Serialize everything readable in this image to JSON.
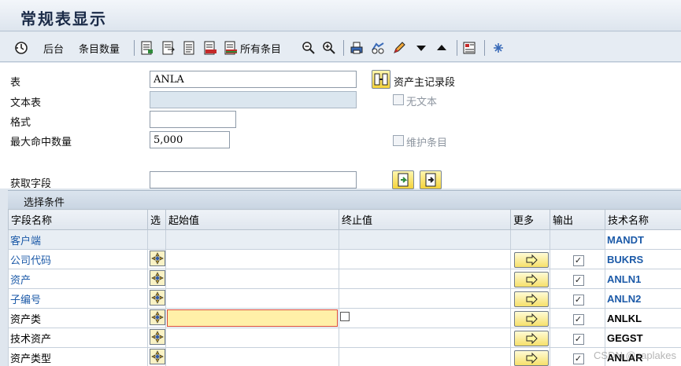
{
  "window": {
    "title": "常规表显示"
  },
  "toolbar": {
    "back_label": "后台",
    "entries_count_label": "条目数量",
    "all_entries_label": "所有条目"
  },
  "form": {
    "table_label": "表",
    "table_value": "ANLA",
    "text_table_label": "文本表",
    "text_table_value": "",
    "format_label": "格式",
    "format_value": "",
    "max_hits_label": "最大命中数量",
    "max_hits_value": "5,000",
    "get_fields_label": "获取字段",
    "get_fields_value": "",
    "asset_master_label": "资产主记录段",
    "no_text_label": "无文本",
    "maintain_entries_label": "维护条目"
  },
  "selection": {
    "header": "选择条件",
    "columns": {
      "field_name": "字段名称",
      "sel": "选",
      "from": "起始值",
      "to": "终止值",
      "more": "更多",
      "output": "输出",
      "tech_name": "技术名称"
    },
    "rows": [
      {
        "name": "客户端",
        "tech": "MANDT",
        "link": true,
        "shaded": true,
        "has_controls": false,
        "output": false
      },
      {
        "name": "公司代码",
        "tech": "BUKRS",
        "link": true,
        "shaded": false,
        "has_controls": true,
        "output": true
      },
      {
        "name": "资产",
        "tech": "ANLN1",
        "link": true,
        "shaded": false,
        "has_controls": true,
        "output": true
      },
      {
        "name": "子编号",
        "tech": "ANLN2",
        "link": true,
        "shaded": false,
        "has_controls": true,
        "output": true
      },
      {
        "name": "资产类",
        "tech": "ANLKL",
        "link": false,
        "shaded": false,
        "has_controls": true,
        "output": true,
        "focused": true
      },
      {
        "name": "技术资产",
        "tech": "GEGST",
        "link": false,
        "shaded": false,
        "has_controls": true,
        "output": true
      },
      {
        "name": "资产类型",
        "tech": "ANLAR",
        "link": false,
        "shaded": false,
        "has_controls": true,
        "output": true
      }
    ]
  },
  "watermark": "CSDN @zaplakes"
}
